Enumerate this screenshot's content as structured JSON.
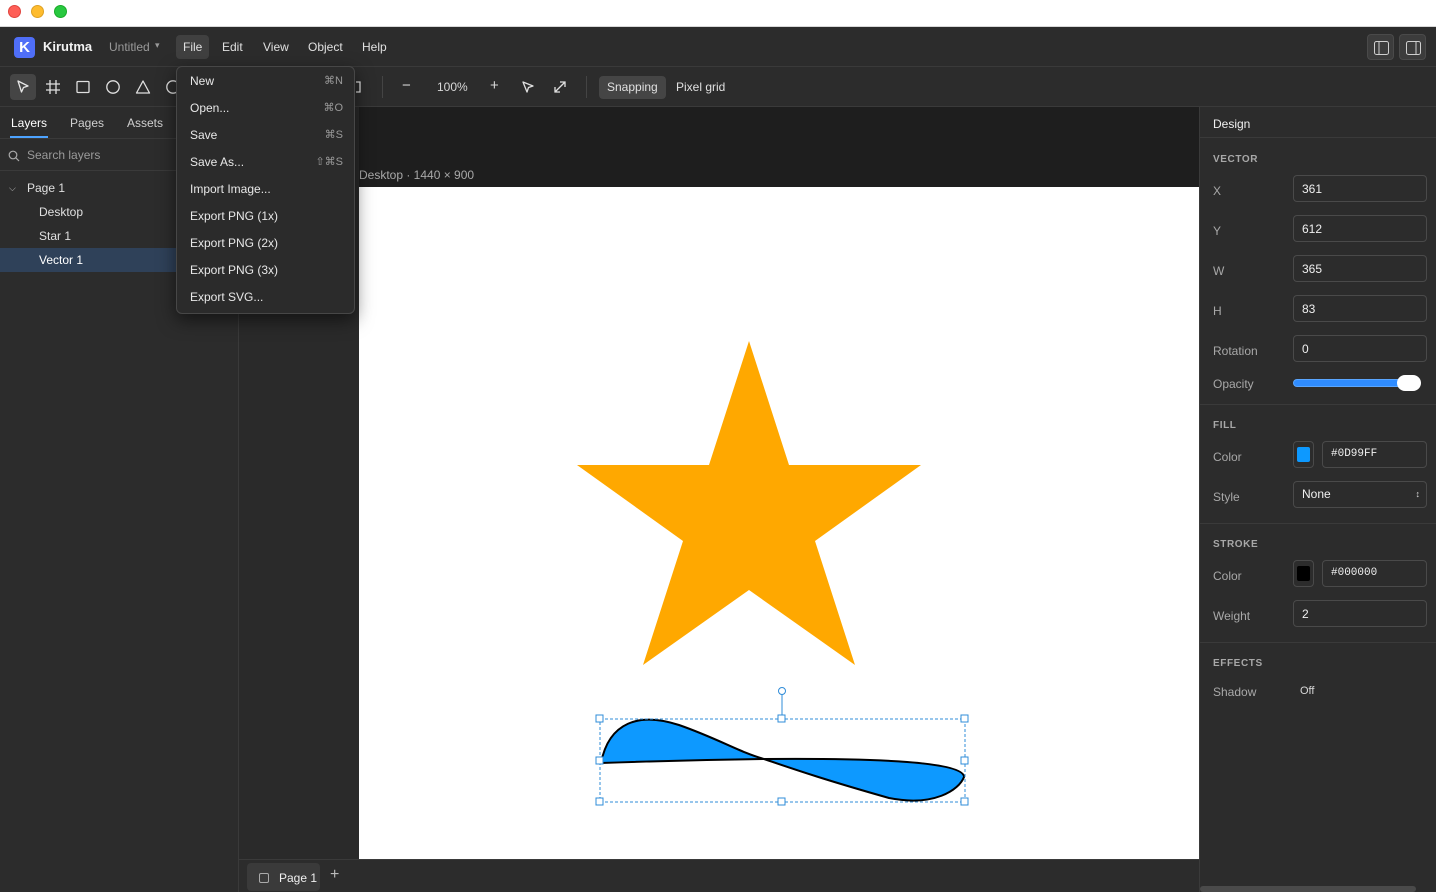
{
  "app": {
    "name": "Kirutma",
    "logo_letter": "K",
    "document_name": "Untitled",
    "document_caret": "▾"
  },
  "menubar": {
    "items": [
      "File",
      "Edit",
      "View",
      "Object",
      "Help"
    ],
    "active": "File"
  },
  "file_menu": [
    {
      "label": "New",
      "shortcut": "⌘N"
    },
    {
      "label": "Open...",
      "shortcut": "⌘O"
    },
    {
      "label": "Save",
      "shortcut": "⌘S"
    },
    {
      "label": "Save As...",
      "shortcut": "⇧⌘S"
    },
    {
      "label": "Import Image...",
      "shortcut": ""
    },
    {
      "label": "Export PNG (1x)",
      "shortcut": ""
    },
    {
      "label": "Export PNG (2x)",
      "shortcut": ""
    },
    {
      "label": "Export PNG (3x)",
      "shortcut": ""
    },
    {
      "label": "Export SVG...",
      "shortcut": ""
    }
  ],
  "toolbar": {
    "tools": [
      "select-tool",
      "frame-tool",
      "rectangle-tool",
      "ellipse-tool",
      "triangle-tool",
      "polygon-tool"
    ],
    "active_tool": "select-tool",
    "zoom_out": "−",
    "zoom_level": "100%",
    "zoom_in": "+",
    "snapping_label": "Snapping",
    "snapping_on": true,
    "pixel_grid_label": "Pixel grid"
  },
  "left_panel": {
    "tabs": [
      "Layers",
      "Pages",
      "Assets"
    ],
    "active_tab": "Layers",
    "search_placeholder": "Search layers",
    "page_name": "Page 1",
    "layers": [
      {
        "name": "Desktop",
        "selected": false
      },
      {
        "name": "Star 1",
        "selected": false
      },
      {
        "name": "Vector 1",
        "selected": true
      }
    ]
  },
  "canvas": {
    "frame_label": "Desktop · 1440 × 900",
    "star_color": "#FFA800",
    "vector_fill": "#0D99FF",
    "vector_stroke": "#000000",
    "selection_color": "#2f8cd8"
  },
  "page_bar": {
    "page_tab_label": "Page 1",
    "add_label": "+"
  },
  "design_panel": {
    "title": "Design",
    "vector": {
      "section_title": "VECTOR",
      "x_label": "X",
      "x": "361",
      "y_label": "Y",
      "y": "612",
      "w_label": "W",
      "w": "365",
      "h_label": "H",
      "h": "83",
      "rotation_label": "Rotation",
      "rotation": "0",
      "opacity_label": "Opacity",
      "opacity": 1.0
    },
    "fill": {
      "section_title": "FILL",
      "color_label": "Color",
      "color": "#0D99FF",
      "style_label": "Style",
      "style": "None",
      "style_caret": "⌃⌄"
    },
    "stroke": {
      "section_title": "STROKE",
      "color_label": "Color",
      "color": "#000000",
      "weight_label": "Weight",
      "weight": "2"
    },
    "effects": {
      "section_title": "EFFECTS",
      "shadow_label": "Shadow",
      "shadow": "Off"
    }
  }
}
